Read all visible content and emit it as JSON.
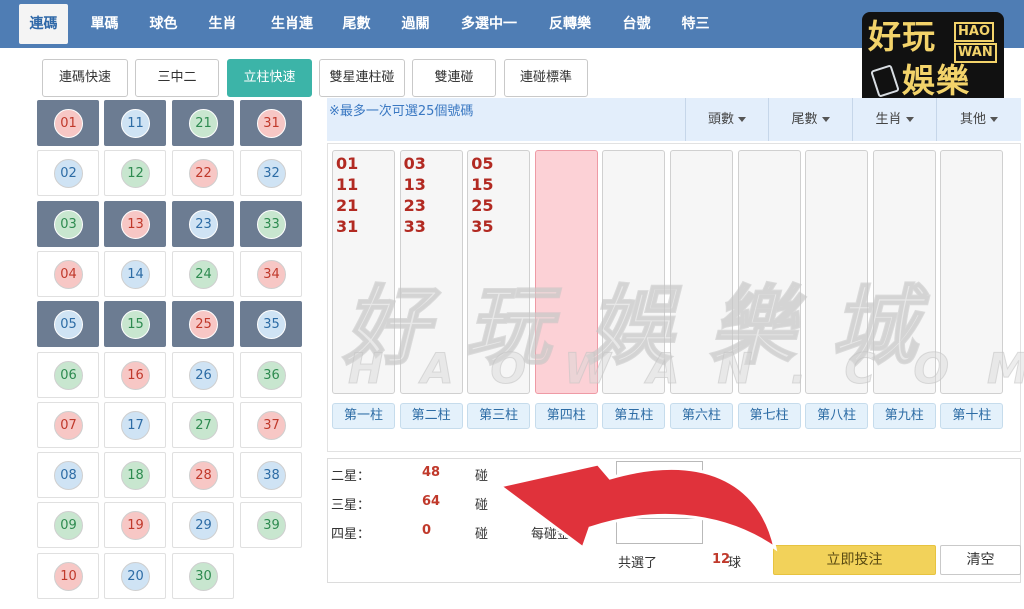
{
  "nav": {
    "tabs": [
      {
        "label": "連碼",
        "active": true
      },
      {
        "label": "單碼"
      },
      {
        "label": "球色"
      },
      {
        "label": "生肖"
      },
      {
        "label": "生肖連"
      },
      {
        "label": "尾數"
      },
      {
        "label": "過關"
      },
      {
        "label": "多選中一"
      },
      {
        "label": "反轉樂"
      },
      {
        "label": "台號"
      },
      {
        "label": "特三"
      }
    ]
  },
  "logo": {
    "line1": "好玩",
    "line2": "娛樂",
    "hao": "HAO",
    "wan": "WAN"
  },
  "modes": [
    {
      "label": "連碼快速"
    },
    {
      "label": "三中二"
    },
    {
      "label": "立柱快速",
      "active": true
    },
    {
      "label": "雙星連柱碰"
    },
    {
      "label": "雙連碰"
    },
    {
      "label": "連碰標準"
    }
  ],
  "numbers": [
    {
      "n": "01",
      "color": "red",
      "selected": true
    },
    {
      "n": "11",
      "color": "blue",
      "selected": true
    },
    {
      "n": "21",
      "color": "green",
      "selected": true
    },
    {
      "n": "31",
      "color": "red",
      "selected": true
    },
    {
      "n": "02",
      "color": "blue"
    },
    {
      "n": "12",
      "color": "green"
    },
    {
      "n": "22",
      "color": "red"
    },
    {
      "n": "32",
      "color": "blue"
    },
    {
      "n": "03",
      "color": "green",
      "selected": true
    },
    {
      "n": "13",
      "color": "red",
      "selected": true
    },
    {
      "n": "23",
      "color": "blue",
      "selected": true
    },
    {
      "n": "33",
      "color": "green",
      "selected": true
    },
    {
      "n": "04",
      "color": "red"
    },
    {
      "n": "14",
      "color": "blue"
    },
    {
      "n": "24",
      "color": "green"
    },
    {
      "n": "34",
      "color": "red"
    },
    {
      "n": "05",
      "color": "blue",
      "selected": true
    },
    {
      "n": "15",
      "color": "green",
      "selected": true
    },
    {
      "n": "25",
      "color": "red",
      "selected": true
    },
    {
      "n": "35",
      "color": "blue",
      "selected": true
    },
    {
      "n": "06",
      "color": "green"
    },
    {
      "n": "16",
      "color": "red"
    },
    {
      "n": "26",
      "color": "blue"
    },
    {
      "n": "36",
      "color": "green"
    },
    {
      "n": "07",
      "color": "red"
    },
    {
      "n": "17",
      "color": "blue"
    },
    {
      "n": "27",
      "color": "green"
    },
    {
      "n": "37",
      "color": "red"
    },
    {
      "n": "08",
      "color": "blue"
    },
    {
      "n": "18",
      "color": "green"
    },
    {
      "n": "28",
      "color": "red"
    },
    {
      "n": "38",
      "color": "blue"
    },
    {
      "n": "09",
      "color": "green"
    },
    {
      "n": "19",
      "color": "red"
    },
    {
      "n": "29",
      "color": "blue"
    },
    {
      "n": "39",
      "color": "green"
    },
    {
      "n": "10",
      "color": "red"
    },
    {
      "n": "20",
      "color": "blue"
    },
    {
      "n": "30",
      "color": "green"
    }
  ],
  "info": {
    "text": "※最多一次可選25個號碼",
    "dropdowns": [
      "頭數",
      "尾數",
      "生肖",
      "其他"
    ]
  },
  "columns": [
    {
      "label": "第一柱",
      "nums": [
        "01",
        "11",
        "21",
        "31"
      ]
    },
    {
      "label": "第二柱",
      "nums": [
        "03",
        "13",
        "23",
        "33"
      ]
    },
    {
      "label": "第三柱",
      "nums": [
        "05",
        "15",
        "25",
        "35"
      ]
    },
    {
      "label": "第四柱",
      "nums": [],
      "highlight": true
    },
    {
      "label": "第五柱",
      "nums": []
    },
    {
      "label": "第六柱",
      "nums": []
    },
    {
      "label": "第七柱",
      "nums": []
    },
    {
      "label": "第八柱",
      "nums": []
    },
    {
      "label": "第九柱",
      "nums": []
    },
    {
      "label": "第十柱",
      "nums": []
    }
  ],
  "watermark": {
    "main": "好玩娛樂城",
    "sub": "HAOWAN.COM.TW"
  },
  "summary": {
    "rows": [
      {
        "label": "二星：",
        "count": "48",
        "unit": "碰"
      },
      {
        "label": "三星：",
        "count": "64",
        "unit": "碰"
      },
      {
        "label": "四星：",
        "count": "0",
        "unit": "碰"
      }
    ],
    "amount_label": "每碰金額：",
    "total_label": "共選了",
    "total_count": "12",
    "total_unit": "球",
    "submit_label": "立即投注",
    "clear_label": "清空"
  },
  "colors": {
    "nav_bg": "#4f7db4",
    "active_mode": "#3cb4a8",
    "selected_cell": "#6c7c92",
    "highlight_column": "#fcd1d6",
    "submit": "#f2d25a",
    "arrow": "#e0323b",
    "count_text": "#c0392b"
  }
}
